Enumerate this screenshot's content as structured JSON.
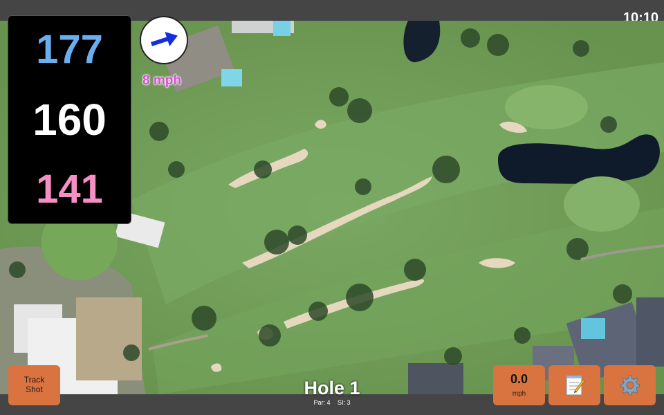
{
  "status_bar": {
    "time": "10:10"
  },
  "yardages": {
    "back": "177",
    "center": "160",
    "front": "141"
  },
  "wind": {
    "speed": "8 mph",
    "icon": "wind-arrow-icon"
  },
  "hole": {
    "title": "Hole 1",
    "par": "Par: 4",
    "si": "SI: 3"
  },
  "buttons": {
    "track_shot": {
      "line1": "Track",
      "line2": "Shot"
    },
    "speed": {
      "value": "0.0",
      "unit": "mph"
    },
    "notes": {
      "icon": "notepad-icon"
    },
    "settings": {
      "icon": "gear-icon"
    }
  },
  "colors": {
    "back_yardage": "#6aaef0",
    "center_yardage": "#ffffff",
    "front_yardage": "#f58fc4",
    "button": "#d9733f",
    "wind_arrow": "#1230e0"
  }
}
